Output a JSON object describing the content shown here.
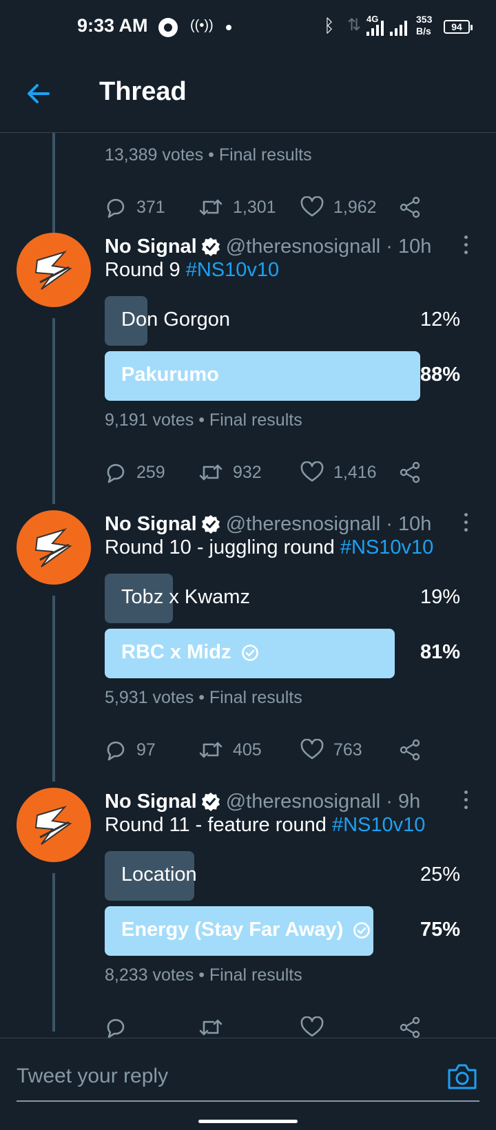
{
  "status_bar": {
    "time": "9:33 AM",
    "network": "4G",
    "speed_value": "353",
    "speed_unit": "B/s",
    "battery": "94"
  },
  "header": {
    "title": "Thread",
    "back_icon": "back-arrow-icon"
  },
  "previous_tweet": {
    "votes": "13,389 votes",
    "status": "Final results",
    "replies": "371",
    "retweets": "1,301",
    "likes": "1,962"
  },
  "tweets": [
    {
      "name": "No Signal",
      "handle": "@theresnosignall",
      "time": "10h",
      "text": "Round 9 ",
      "hashtag": "#NS10v10",
      "options": [
        {
          "label": "Don Gorgon",
          "percent": "12%",
          "share": 0.12,
          "winner": false
        },
        {
          "label": "Pakurumo",
          "percent": "88%",
          "share": 0.88,
          "winner": true
        }
      ],
      "votes": "9,191 votes",
      "status": "Final results",
      "replies": "259",
      "retweets": "932",
      "likes": "1,416"
    },
    {
      "name": "No Signal",
      "handle": "@theresnosignall",
      "time": "10h",
      "text": "Round 10 - juggling round ",
      "hashtag": "#NS10v10",
      "options": [
        {
          "label": "Tobz x Kwamz",
          "percent": "19%",
          "share": 0.19,
          "winner": false
        },
        {
          "label": "RBC x Midz",
          "percent": "81%",
          "share": 0.81,
          "winner": true
        }
      ],
      "votes": "5,931 votes",
      "status": "Final results",
      "replies": "97",
      "retweets": "405",
      "likes": "763"
    },
    {
      "name": "No Signal",
      "handle": "@theresnosignall",
      "time": "9h",
      "text": "Round 11 - feature round ",
      "hashtag": "#NS10v10",
      "options": [
        {
          "label": "Location",
          "percent": "25%",
          "share": 0.25,
          "winner": false
        },
        {
          "label": "Energy (Stay Far Away)",
          "percent": "75%",
          "share": 0.75,
          "winner": true
        }
      ],
      "votes": "8,233 votes",
      "status": "Final results",
      "replies": "",
      "retweets": "",
      "likes": ""
    }
  ],
  "reply": {
    "placeholder": "Tweet your reply"
  },
  "colors": {
    "background": "#15202b",
    "accent": "#1da1f2",
    "poll_winner": "#a3dcfa",
    "poll_loser": "#3d5466",
    "muted": "#8899a6",
    "avatar": "#f26b1d"
  }
}
